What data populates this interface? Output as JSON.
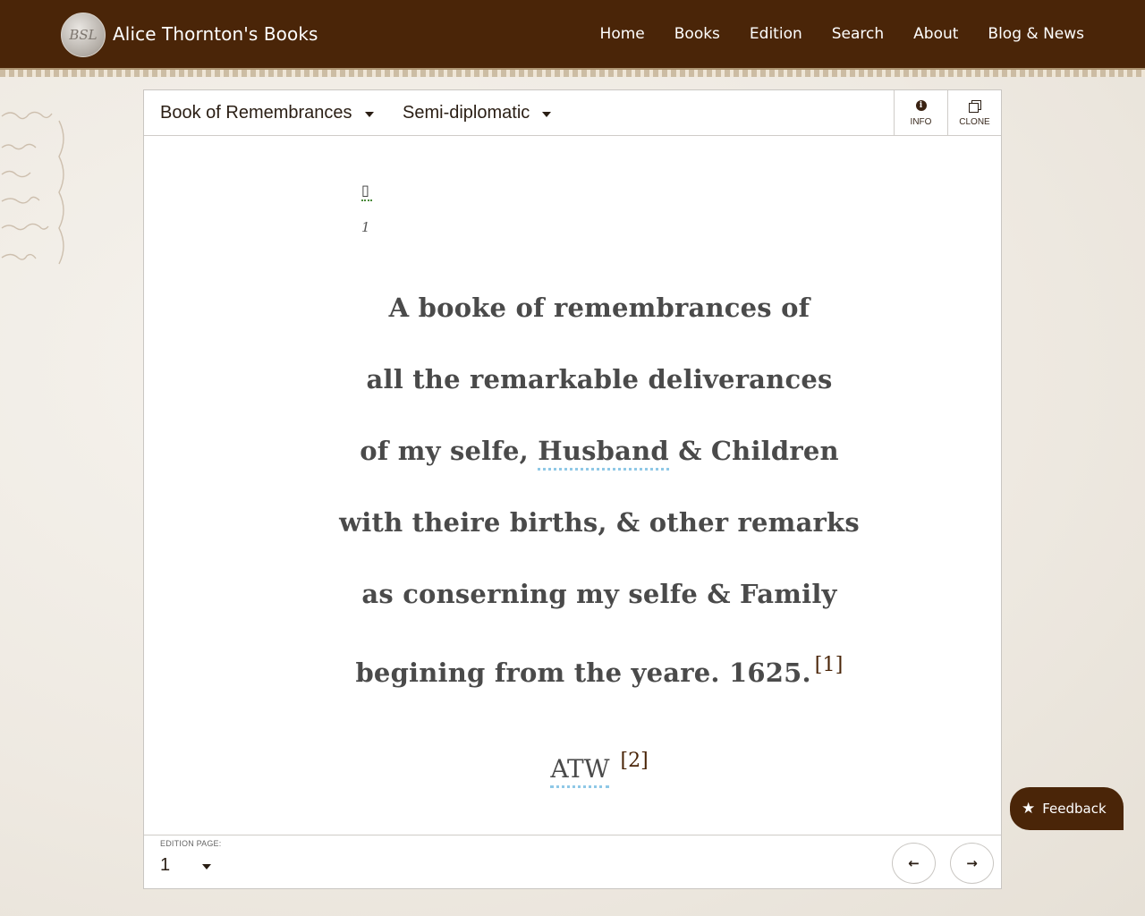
{
  "header": {
    "brand": "Alice Thornton's Books",
    "logo_text": "BSL",
    "nav": [
      "Home",
      "Books",
      "Edition",
      "Search",
      "About",
      "Blog & News"
    ]
  },
  "toolbar": {
    "book_select": "Book of Remembrances",
    "view_select": "Semi-diplomatic",
    "info_label": "INFO",
    "clone_label": "CLONE"
  },
  "content": {
    "page_marker": "▯",
    "page_number": "1",
    "lines": [
      "A booke of remembrances of",
      "all the remarkable deliverances",
      "of my selfe,",
      "Husband",
      "& Children",
      "with theire births, & other remarks",
      "as conserning my selfe & Family",
      "begining from the yeare. 1625."
    ],
    "footnote1": "[1]",
    "signature": "ATW",
    "footnote2": "[2]"
  },
  "footer": {
    "edition_page_label": "EDITION PAGE:",
    "edition_page_value": "1",
    "prev_icon": "arrow-left-icon",
    "next_icon": "arrow-right-icon"
  },
  "feedback": {
    "label": "Feedback"
  },
  "colors": {
    "header_bg": "#4a2508",
    "link_underline": "#8fc8e6",
    "footnote": "#4a2508"
  }
}
